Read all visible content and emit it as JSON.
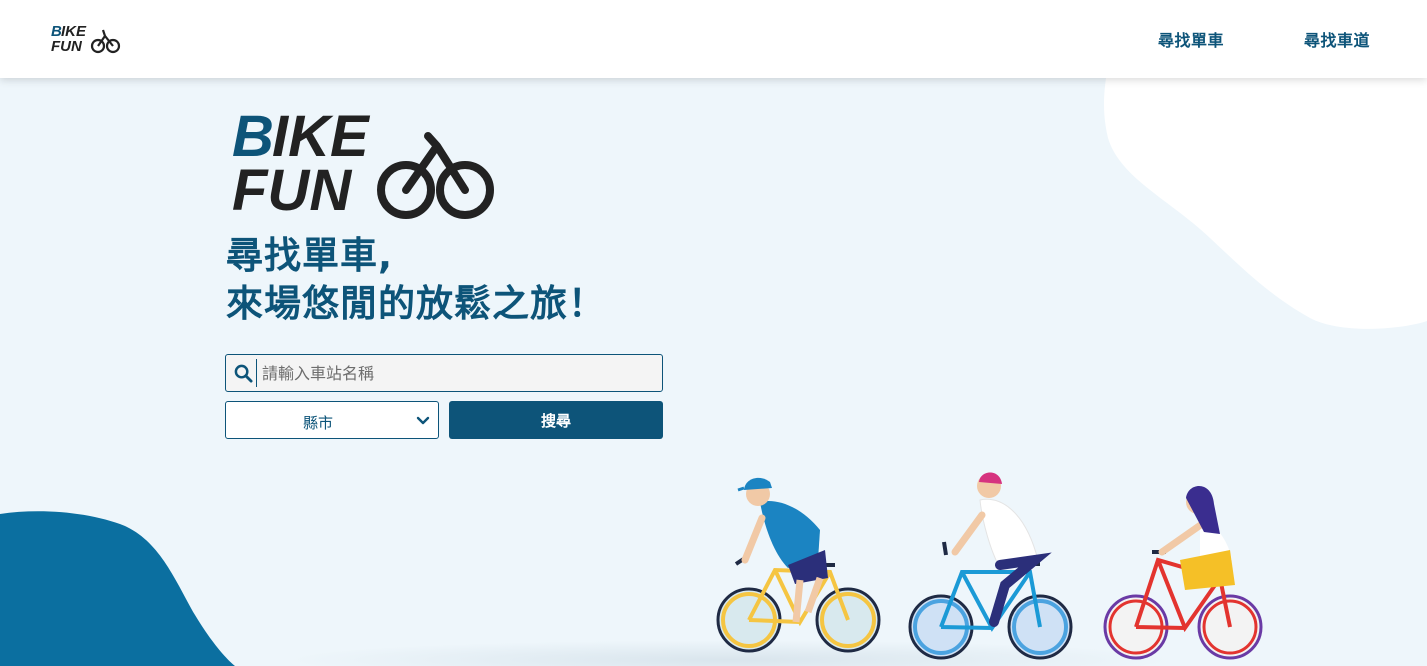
{
  "header": {
    "logo_alt": "BIKE FUN",
    "nav": [
      {
        "label": "尋找單車"
      },
      {
        "label": "尋找車道"
      }
    ]
  },
  "hero": {
    "logo_alt": "BIKE FUN",
    "title_line1": "尋找單車,",
    "title_line2": "來場悠閒的放鬆之旅！"
  },
  "search": {
    "placeholder": "請輸入車站名稱",
    "value": "",
    "icon": "search-icon"
  },
  "city_select": {
    "selected": "縣市",
    "icon": "chevron-down-icon"
  },
  "search_button": {
    "label": "搜尋"
  },
  "colors": {
    "brand": "#0d5479",
    "background": "#eef6fb",
    "blob": "#0b6fa0"
  }
}
